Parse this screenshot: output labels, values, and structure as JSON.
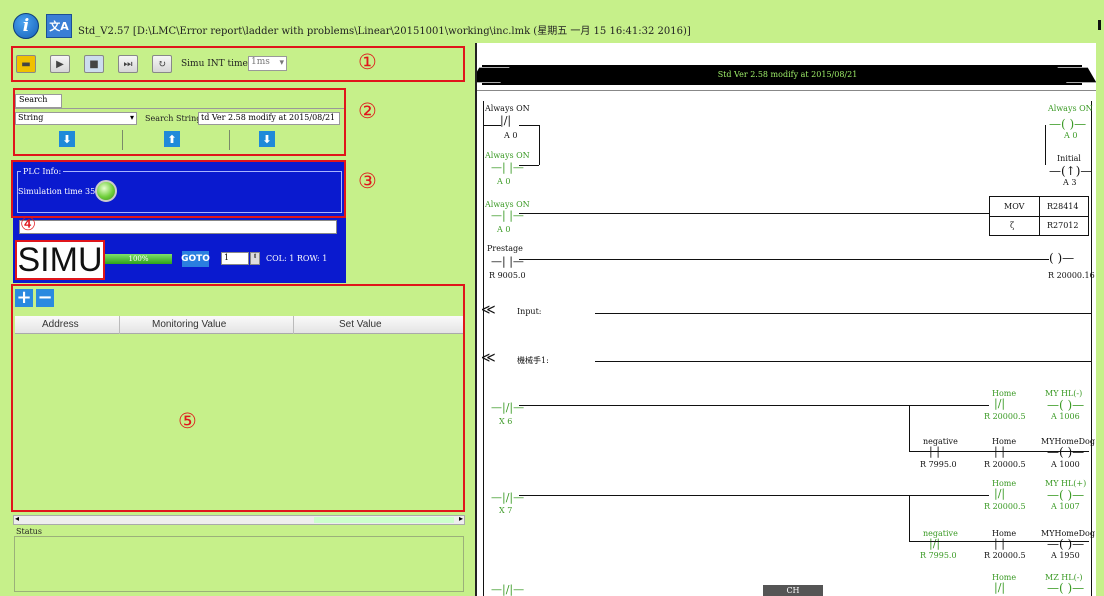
{
  "titlebar": {
    "text": "Std_V2.57 [D:\\LMC\\Error report\\ladder with problems\\Linear\\20151001\\working\\inc.lmk (星期五 一月 15 16:41:32 2016)]"
  },
  "toolbar": {
    "simu_time_label": "Simu INT time",
    "simu_time_value": "1ms"
  },
  "annotations": [
    "①",
    "②",
    "③",
    "④",
    "⑤"
  ],
  "search": {
    "tab": "Search",
    "type": "String",
    "string_label": "Search String",
    "string_value": "td Ver 2.58 modify at 2015/08/21"
  },
  "plc": {
    "group": "PLC Info:",
    "sim_time": "Simulation time 350 ms",
    "mode": "SIMU",
    "progress_text": "100%",
    "goto": "GOTO",
    "goto_value": "1",
    "colrow": "COL: 1 ROW: 1"
  },
  "monitor": {
    "columns": [
      "Address",
      "Monitoring Value",
      "Set Value"
    ],
    "add": "+",
    "remove": "−"
  },
  "status": {
    "label": "Status"
  },
  "ladder": {
    "header": "Std Ver 2.58 modify at 2015/08/21",
    "c1": "Always ON",
    "a0": "A 0",
    "init": "Initial",
    "a3": "A 3",
    "mov": "MOV",
    "r1": "R28414",
    "r2": "R27012",
    "mov_sym": "ζ",
    "prestage": "Prestage",
    "r9005": "R 9005.0",
    "r20016": "R 20000.16",
    "input": "Input:",
    "mech": "機械手1:",
    "home": "Home",
    "r200005": "R 20000.5",
    "myhl": "MY HL(-)",
    "a1006": "A 1006",
    "negative": "negative",
    "r7995": "R 7995.0",
    "myhomedog": "MYHomeDog",
    "a1000": "A 1000",
    "myhl2": "MY HL(+)",
    "a1007": "A 1007",
    "a1950": "A 1950",
    "mzhl": "MZ HL(-)",
    "x6": "X 6",
    "x7": "X 7",
    "ime": "CH"
  }
}
